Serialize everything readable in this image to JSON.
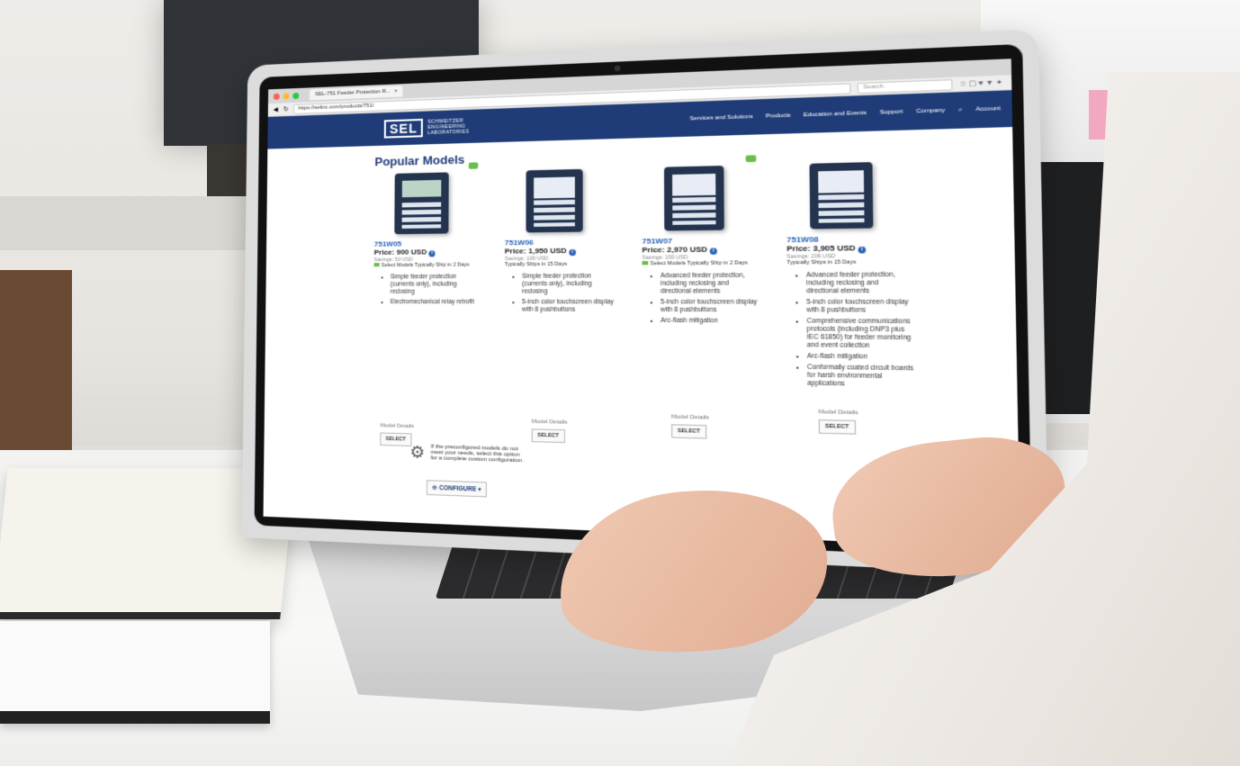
{
  "browser": {
    "tab_title": "SEL-751 Feeder Protection R...",
    "url": "https://selinc.com/products/751/",
    "search_placeholder": "Search"
  },
  "site": {
    "logo_mark": "SEL",
    "logo_text": "SCHWEITZER ENGINEERING LABORATORIES",
    "nav": [
      "Services and Solutions",
      "Products",
      "Education and Events",
      "Support",
      "Company",
      "Account"
    ]
  },
  "page": {
    "title": "Popular Models",
    "models": [
      {
        "part": "751W05",
        "price": "Price: 900 USD",
        "savings": "Savings: 50 USD",
        "shipping": "Select Models Typically Ship in 2 Days",
        "features": [
          "Simple feeder protection (currents only), including reclosing",
          "Electromechanical relay retrofit"
        ],
        "details_link": "Model Details",
        "select_label": "SELECT"
      },
      {
        "part": "751W06",
        "price": "Price: 1,950 USD",
        "savings": "Savings: 100 USD",
        "shipping": "Typically Ships in 15 Days",
        "features": [
          "Simple feeder protection (currents only), including reclosing",
          "5-inch color touchscreen display with 8 pushbuttons"
        ],
        "details_link": "Model Details",
        "select_label": "SELECT"
      },
      {
        "part": "751W07",
        "price": "Price: 2,970 USD",
        "savings": "Savings: 150 USD",
        "shipping": "Select Models Typically Ship in 2 Days",
        "features": [
          "Advanced feeder protection, including reclosing and directional elements",
          "5-inch color touchscreen display with 8 pushbuttons",
          "Arc-flash mitigation"
        ],
        "details_link": "Model Details",
        "select_label": "SELECT"
      },
      {
        "part": "751W08",
        "price": "Price: 3,905 USD",
        "savings": "Savings: 206 USD",
        "shipping": "Typically Ships in 15 Days",
        "features": [
          "Advanced feeder protection, including reclosing and directional elements",
          "5-inch color touchscreen display with 8 pushbuttons",
          "Comprehensive communications protocols (including DNP3 plus IEC 61850) for feeder monitoring and event collection",
          "Arc-flash mitigation",
          "Conformally coated circuit boards for harsh environmental applications"
        ],
        "details_link": "Model Details",
        "select_label": "SELECT"
      }
    ],
    "custom_text": "If the preconfigured models do not meet your needs, select this option for a complete custom configuration.",
    "configure_label": "CONFIGURE"
  },
  "colors": {
    "brand_navy": "#1f3c78",
    "accent_blue": "#2a62b8",
    "ship_green": "#6abf4b"
  }
}
